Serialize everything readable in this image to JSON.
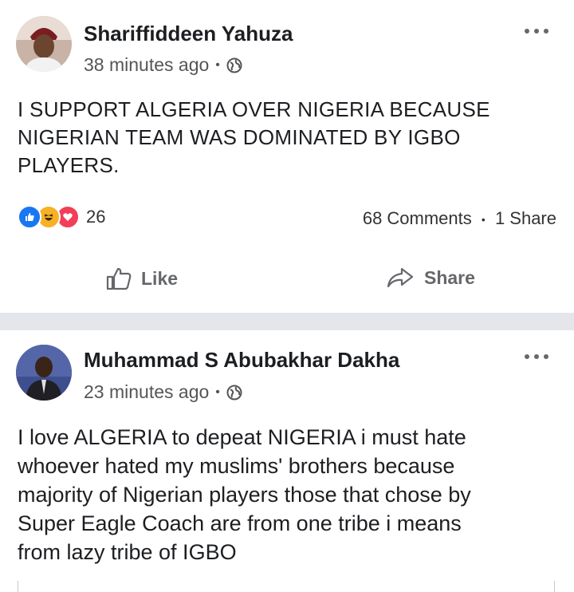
{
  "posts": [
    {
      "author": "Shariffiddeen Yahuza",
      "time": "38 minutes ago",
      "separator": "•",
      "text": "I SUPPORT ALGERIA OVER NIGERIA BECAUSE\nNIGERIAN TEAM WAS DOMINATED BY IGBO\nPLAYERS.",
      "reaction_icons": [
        "like-reaction-icon",
        "haha-reaction-icon",
        "love-reaction-icon"
      ],
      "reaction_count": "26",
      "comments": "68 Comments",
      "shares": "1 Share",
      "actions": {
        "like": "Like",
        "share": "Share"
      }
    },
    {
      "author": "Muhammad S Abubakhar Dakha",
      "time": "23 minutes ago",
      "separator": "•",
      "text": "I love ALGERIA to depeat NIGERIA  i must hate\nwhoever hated my muslims' brothers because\nmajority of Nigerian players those that chose by\nSuper Eagle Coach are from one tribe i means\nfrom lazy tribe of IGBO"
    }
  ],
  "colors": {
    "like_blue": "#1877f2",
    "love_red": "#f33e58",
    "haha_yellow": "#f7b125",
    "muted_text": "#65676b",
    "divider": "#e4e6eb"
  }
}
